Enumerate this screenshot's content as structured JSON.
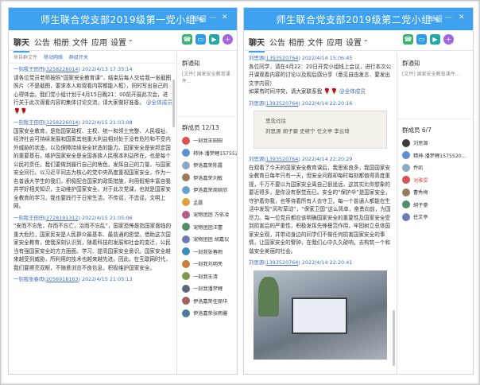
{
  "left": {
    "title": "师生联合党支部2019级第一党小组",
    "header_ctrl": "举报",
    "tabs": [
      "聊天",
      "公告",
      "相册",
      "文件",
      "应用",
      "设置"
    ],
    "subbar": {
      "a": "来自群文件",
      "b": "移动网络",
      "c": "群组开关"
    },
    "messages": [
      {
        "sender": "一刻我王田田",
        "qq": "3258226014",
        "time": "2022/4/13 17:35:14",
        "body": "请各位党员老师按照“国家安全教育课”，结束后每人交给我一张截图照片（不是截图，要求本人和观看内容都能入框），同时写出自己的心得体会。我们党小组计划于4月15日晚21：00前开展此次会，进行关于此次观看内容的集体讨论交流，请大家做好准备。",
        "mention": "@全体成员"
      },
      {
        "sender": "一刻我王田田",
        "qq": "3258226014",
        "time": "2022/4/15 21:03:08",
        "body": "国家安全教育，是指国家政权、主权、统一和领土完整、人民福祉、经济社会可持续发展和国家其他重大利益相对处于没有危险和不受内外威胁的状态，以及保障持续安全状态的能力。国家安全是安邦定国的重要基石，维护国家安全是全国各族人民根本利益所在，也是每个公民的责任。我们要做到履行自己的角色，发挥自己的力量，与国家安全同行。以习近平同志为核心的党中央高度重视国家安全，作为一名普通大学生的我们，积极配合国家的政策措施，利用假期丰富自我并学好相关知识，主动维护国家安全。对于此次党课，也就是国家安全教育的学习，我也要践行于日常生活，不传谣，不造谣，文明上网。"
      },
      {
        "sender": "一刻我王田田",
        "qq": "2728191312",
        "time": "2022/4/15 21:05:06",
        "body": "“安而不忘危，存而不忘亡，治而不忘乱”，国家恐怖是指国家面临的重大危险，国家民安是人民群众最基本、最普通的愿望。借助这次国家安全教育，使我深刻认识到，随着科技的发展和社会的变迁，公民当有强国家安全的方方面面。学习、提高国家安全意识。国家安全越来越受到威胁，所利用的技术也越来越先进。因此，在互联网时代，我们要擦亮双眼，不随意浏览不良信息，积极维护国家安全。"
      },
      {
        "sender": "一刻我张春雨",
        "qq": "2056918163",
        "time": "2022/4/15 21:05:13",
        "body": ""
      }
    ],
    "notice_h": "群通知",
    "notice_text": "[文件] 国家安全教育课件...",
    "members_h": "群成员 12/13",
    "members": [
      {
        "name": "一刻我王田田",
        "color": "#d9534f"
      },
      {
        "name": "柿钟-潘梦鲤1575520...",
        "color": "#5b8fd6"
      },
      {
        "name": "伊洛嘉荣陈露",
        "color": "#8da9c4"
      },
      {
        "name": "伊洛嘉荣刘敏",
        "color": "#9b7b5e"
      },
      {
        "name": "伊洛嘉荣周婉欣",
        "color": "#6aa1cc"
      },
      {
        "name": "孟露",
        "color": "#e0a040"
      },
      {
        "name": "宠物团团 方依凌",
        "color": "#b55d8a"
      },
      {
        "name": "宠物团团汪蕾",
        "color": "#4d8f6b"
      },
      {
        "name": "宠物团团 胡嘉仪",
        "color": "#6c7bb8"
      },
      {
        "name": "一刻我张春雨",
        "color": "#3c8dbc"
      },
      {
        "name": "一刻我刘明亮",
        "color": "#c77e3a"
      },
      {
        "name": "一刻我王清",
        "color": "#7d9a4a"
      },
      {
        "name": "一刻我潘梦鲤",
        "color": "#5a6a7a"
      },
      {
        "name": "伊洛嘉荣任丽华",
        "color": "#a45c5c"
      },
      {
        "name": "伊洛嘉荣张雨馨",
        "color": "#4b79a1"
      }
    ]
  },
  "right": {
    "title": "师生联合党支部2019级第二党小组",
    "header_ctrl": "举报",
    "tabs": [
      "聊天",
      "公告",
      "相册",
      "文件",
      "应用",
      "设置"
    ],
    "messages": [
      {
        "sender": "刘思源",
        "qq": "1393520764",
        "time": "2022/4/14 15:06:45",
        "body": "各位同学，请在4月22：20日开党小组线上会议，进行本次公开课观看内容的讨论以及观后感分享（意见自由发言、要发出文字内容）",
        "tail": "如果有时间冲突，请大家联系我",
        "mention": "@全体成员"
      },
      {
        "sender": "刘思源",
        "qq": "1393520764",
        "time": "2022/4/14 22:20:16",
        "card": true
      },
      {
        "sender": "刘思源",
        "qq": "1393520764",
        "time": "2022/4/14 22:20:29",
        "body": "在观看了今天的国家安全教育课后，我思索良多，我国国家安全教育日每年只有一天，但安全问题却每时每刻都值得高度重视，千万不要以为国家安全离自己很遥远，这其实比你想象的要近得多，是你没有察觉而已。安全的“保护伞”是国家安全，守护着你我，也等待着所有人去守卫。每一个普通人都能在生活中发现“风吹草动”，“保家卫国”这么简单，奋勇向前，为国尽力。每一位党员都应该明确国家安全的重要性及国家安全受到损害后的严重性，积极发挥先锋模范作用，牢固树立总体国家安全观，并带动身边的同学们不做任何损害国家安全的事情，让国家安全的警钟，在我们心中久久敲响，去构筑一个和谐安全美丽的社会。"
      },
      {
        "sender": "刘思源",
        "qq": "1393520764",
        "time": "2022/4/14 22:20:41",
        "photo": true
      }
    ],
    "card_lines": [
      "思念过往",
      "刘思源  胡子豪  史继宁  任文亭  李云琦"
    ],
    "notice_h": "群通知",
    "notice_text": "[文件] 国家安全教育课件...",
    "members_h": "群成员 6/7",
    "members": [
      {
        "name": "刘思源",
        "color": "#3b3b3b"
      },
      {
        "name": "精神-潘梦鲤1575520...",
        "color": "#5b8fd6"
      },
      {
        "name": "乔凯",
        "color": "#8da9c4"
      },
      {
        "name": "池雅雯",
        "color": "#d9534f"
      },
      {
        "name": "曹秀梅",
        "color": "#9b7b5e"
      },
      {
        "name": "胡子豪",
        "color": "#4d8f6b"
      },
      {
        "name": "任文亭",
        "color": "#6c7bb8"
      }
    ]
  }
}
